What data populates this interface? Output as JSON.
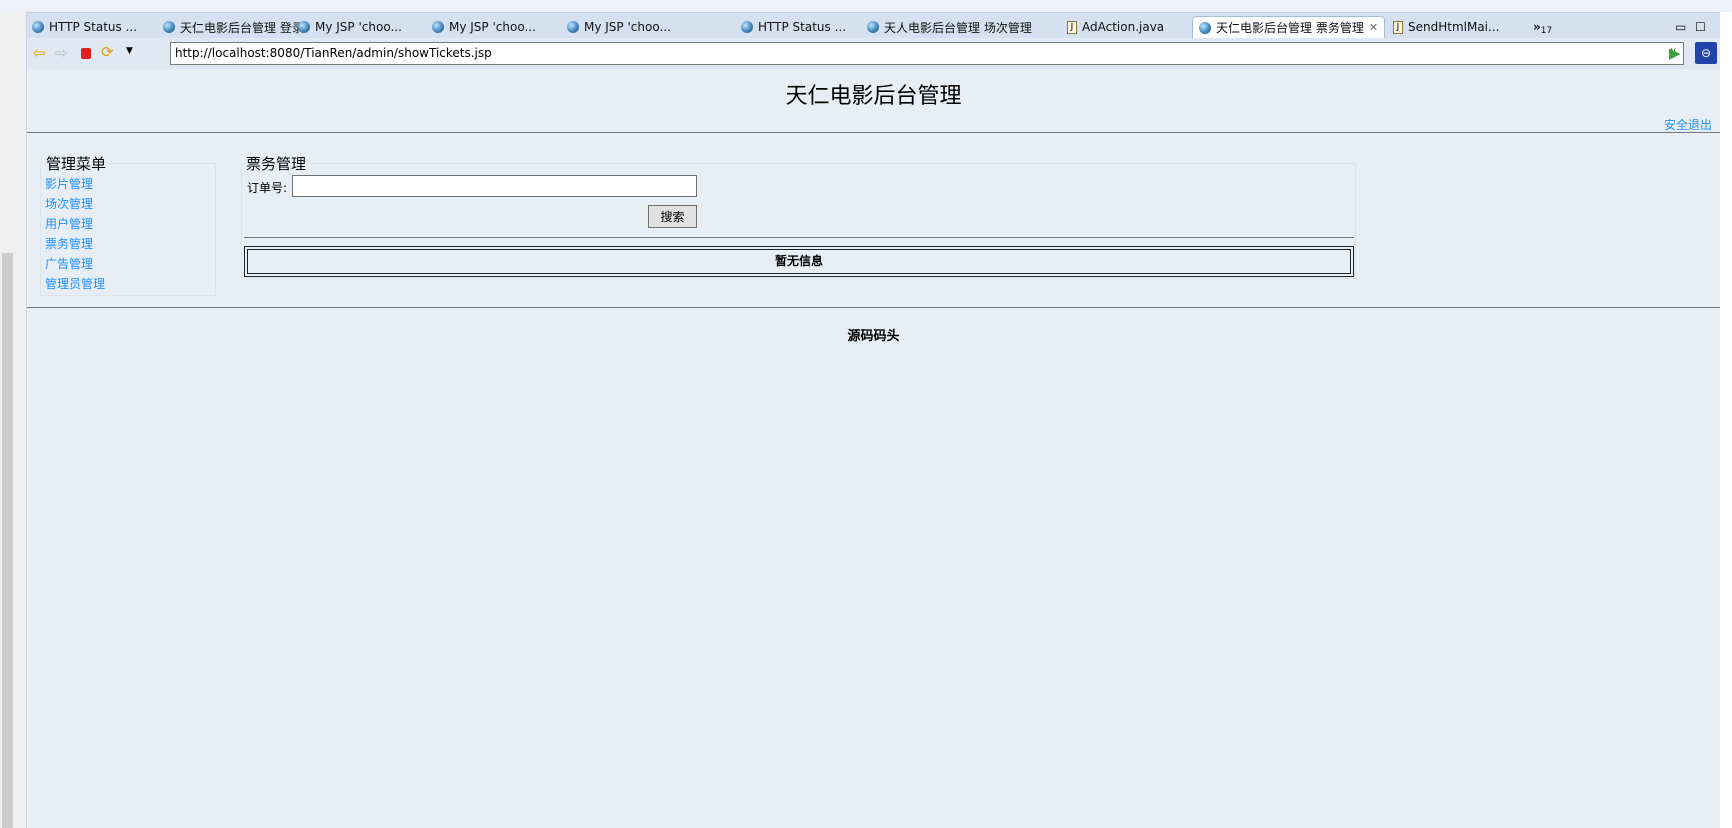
{
  "browser": {
    "tabs": [
      {
        "label": "HTTP Status ...",
        "icon": "globe-icon"
      },
      {
        "label": "天仁电影后台管理 登录",
        "icon": "globe-icon"
      },
      {
        "label": "My JSP 'choo...",
        "icon": "globe-icon"
      },
      {
        "label": "My JSP 'choo...",
        "icon": "globe-icon"
      },
      {
        "label": "My JSP 'choo...",
        "icon": "globe-icon"
      },
      {
        "label": "HTTP Status ...",
        "icon": "globe-icon"
      },
      {
        "label": "天人电影后台管理 场次管理",
        "icon": "globe-icon"
      },
      {
        "label": "AdAction.java",
        "icon": "java-file-icon"
      },
      {
        "label": "天仁电影后台管理 票务管理",
        "icon": "globe-icon",
        "active": true
      },
      {
        "label": "SendHtmlMai...",
        "icon": "java-file-icon"
      }
    ],
    "overflow_label": "»",
    "overflow_count": "17",
    "url": "http://localhost:8080/TianRen/admin/showTickets.jsp"
  },
  "page": {
    "title": "天仁电影后台管理",
    "logout": "安全退出",
    "menu": {
      "legend": "管理菜单",
      "items": [
        "影片管理",
        "场次管理",
        "用户管理",
        "票务管理",
        "广告管理",
        "管理员管理"
      ]
    },
    "tickets": {
      "legend": "票务管理",
      "order_label": "订单号:",
      "order_value": "",
      "search_button": "搜索",
      "empty_text": "暂无信息"
    },
    "footer": "源码码头"
  }
}
